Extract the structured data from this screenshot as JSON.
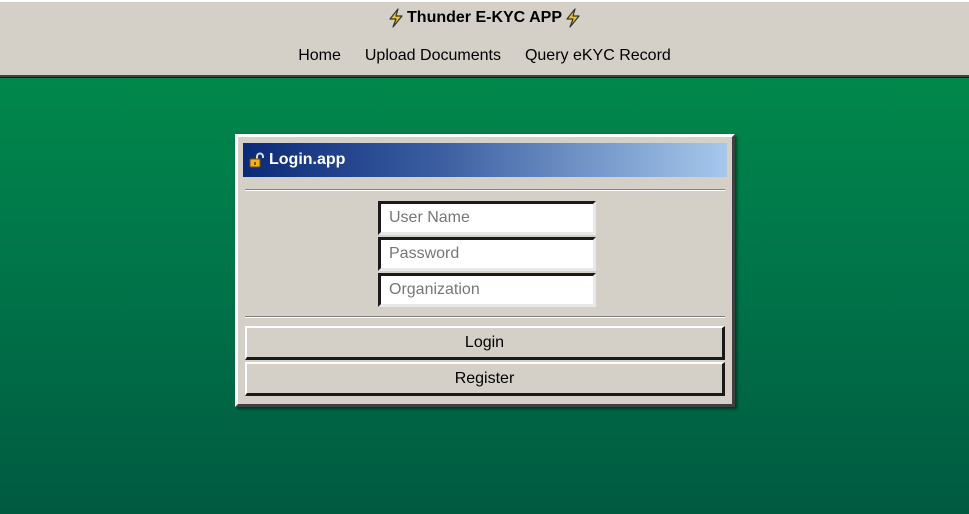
{
  "header": {
    "title": "Thunder E-KYC APP",
    "title_icon": "lightning-bolt-icon",
    "nav": [
      "Home",
      "Upload Documents",
      "Query eKYC Record"
    ]
  },
  "login_window": {
    "title": "Login.app",
    "title_icon": "padlock-icon",
    "username_placeholder": "User Name",
    "username_value": "",
    "password_placeholder": "Password",
    "password_value": "",
    "organization_placeholder": "Organization",
    "organization_value": "",
    "login_label": "Login",
    "register_label": "Register"
  },
  "colors": {
    "background_top": "#008f4a",
    "background_bottom": "#005a40",
    "panel": "#d4d0c8",
    "titlebar_start": "#0a2a78",
    "titlebar_end": "#a6c8ec",
    "bolt": "#f5c518"
  }
}
